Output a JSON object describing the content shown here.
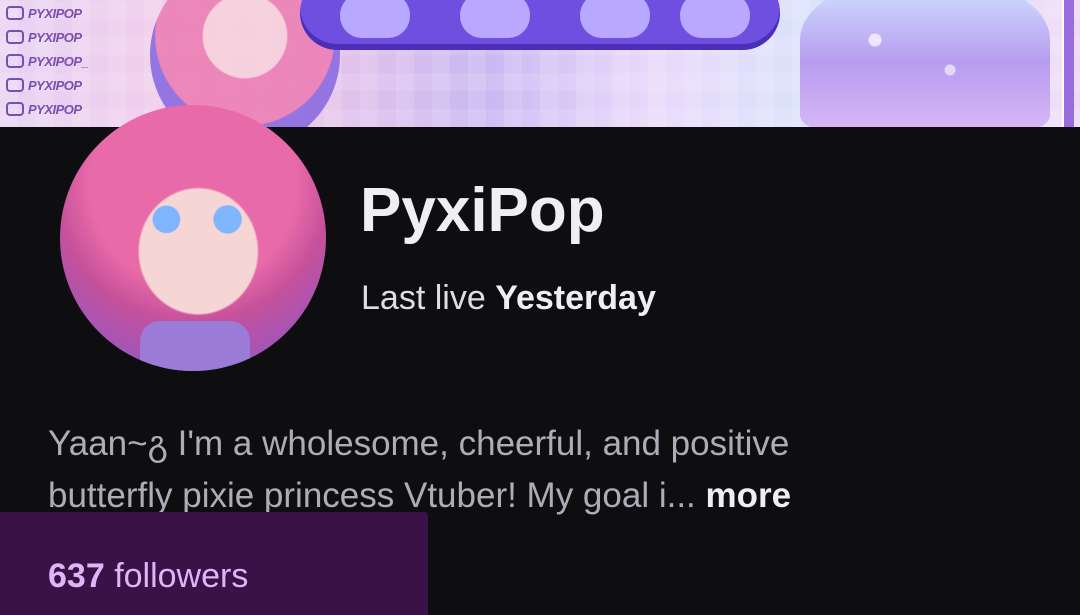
{
  "banner": {
    "socials": [
      {
        "icon": "twitch-icon",
        "label": "PYXIPOP"
      },
      {
        "icon": "crown-icon",
        "label": "PYXIPOP"
      },
      {
        "icon": "twitter-icon",
        "label": "PYXIPOP_"
      },
      {
        "icon": "heart-icon",
        "label": "PYXIPOP"
      },
      {
        "icon": "youtube-icon",
        "label": "PYXIPOP"
      }
    ]
  },
  "profile": {
    "channel_name": "PyxiPop",
    "last_live_label": "Last live",
    "last_live_value": "Yesterday"
  },
  "bio": {
    "line1": "Yaan~გ I'm a wholesome, cheerful, and positive",
    "line2": "butterfly pixie princess Vtuber! My goal i...",
    "more": "more"
  },
  "stats": {
    "followers_count": "637",
    "followers_label": "followers"
  },
  "colors": {
    "background": "#0e0e10",
    "followers_accent": "#dcb6f7",
    "followers_bar": "#3b1247"
  }
}
